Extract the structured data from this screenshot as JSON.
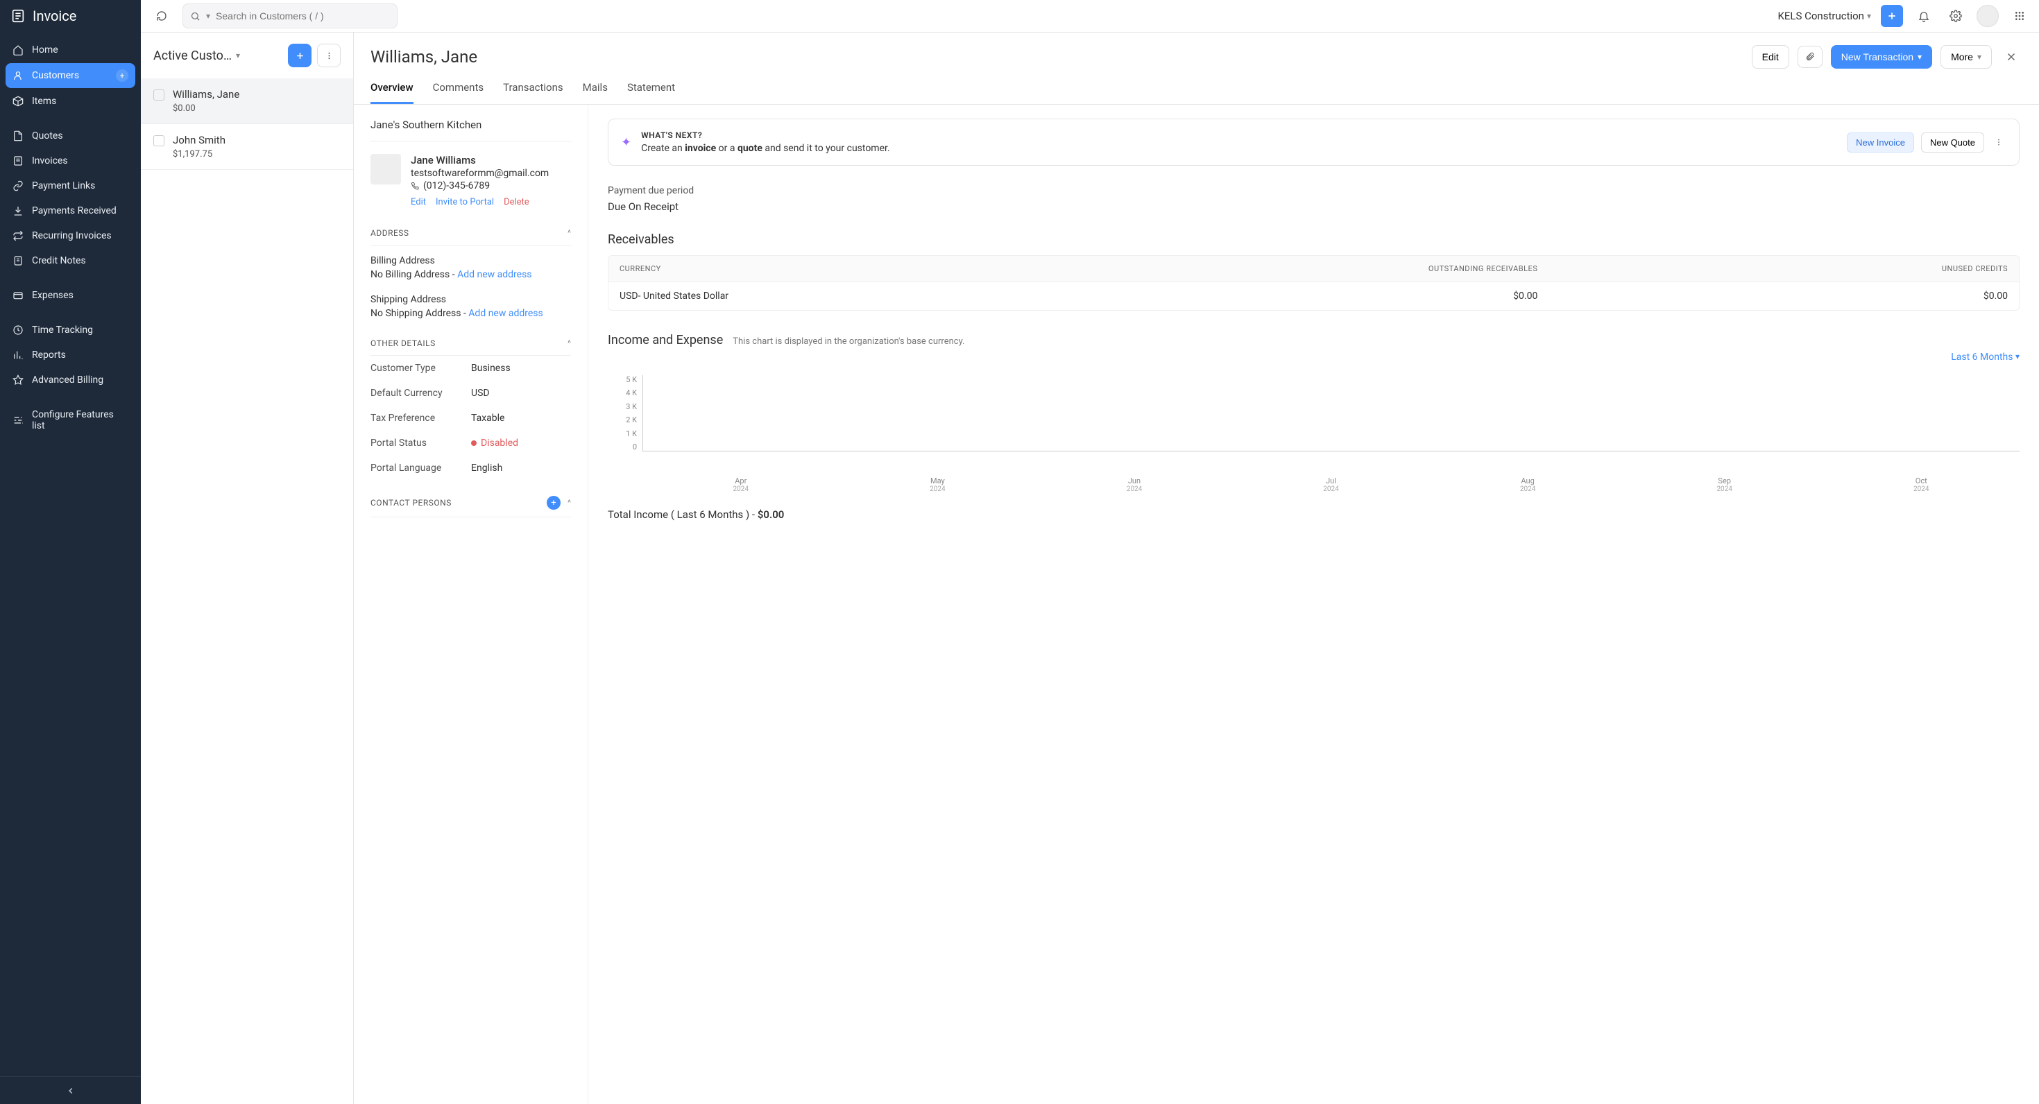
{
  "app": {
    "name": "Invoice"
  },
  "search": {
    "placeholder": "Search in Customers ( / )"
  },
  "org": {
    "name": "KELS Construction"
  },
  "sidebar": {
    "items": [
      {
        "label": "Home"
      },
      {
        "label": "Customers"
      },
      {
        "label": "Items"
      },
      {
        "label": "Quotes"
      },
      {
        "label": "Invoices"
      },
      {
        "label": "Payment Links"
      },
      {
        "label": "Payments Received"
      },
      {
        "label": "Recurring Invoices"
      },
      {
        "label": "Credit Notes"
      },
      {
        "label": "Expenses"
      },
      {
        "label": "Time Tracking"
      },
      {
        "label": "Reports"
      },
      {
        "label": "Advanced Billing"
      },
      {
        "label": "Configure Features list"
      }
    ]
  },
  "listHeader": {
    "title": "Active Custo…"
  },
  "customers": [
    {
      "name": "Williams, Jane",
      "amount": "$0.00"
    },
    {
      "name": "John Smith",
      "amount": "$1,197.75"
    }
  ],
  "detail": {
    "title": "Williams, Jane",
    "buttons": {
      "edit": "Edit",
      "newTxn": "New Transaction",
      "more": "More"
    },
    "tabs": [
      "Overview",
      "Comments",
      "Transactions",
      "Mails",
      "Statement"
    ],
    "company": "Jane's Southern Kitchen",
    "contact": {
      "name": "Jane Williams",
      "email": "testsoftwareformm@gmail.com",
      "phone": "(012)-345-6789",
      "actions": {
        "edit": "Edit",
        "invite": "Invite to Portal",
        "delete": "Delete"
      }
    },
    "addressSection": {
      "title": "ADDRESS",
      "billing": {
        "label": "Billing Address",
        "empty": "No Billing Address - ",
        "add": "Add new address"
      },
      "shipping": {
        "label": "Shipping Address",
        "empty": "No Shipping Address - ",
        "add": "Add new address"
      }
    },
    "otherSection": {
      "title": "OTHER DETAILS",
      "rows": {
        "custType": {
          "k": "Customer Type",
          "v": "Business"
        },
        "currency": {
          "k": "Default Currency",
          "v": "USD"
        },
        "tax": {
          "k": "Tax Preference",
          "v": "Taxable"
        },
        "portal": {
          "k": "Portal Status",
          "v": "Disabled"
        },
        "lang": {
          "k": "Portal Language",
          "v": "English"
        }
      }
    },
    "contactPersons": {
      "title": "CONTACT PERSONS"
    }
  },
  "whatsNext": {
    "title": "WHAT'S NEXT?",
    "text_pre": "Create an ",
    "text_bold1": "invoice",
    "text_mid": " or a ",
    "text_bold2": "quote",
    "text_post": " and send it to your customer.",
    "invoiceBtn": "New Invoice",
    "quoteBtn": "New Quote"
  },
  "duePeriod": {
    "label": "Payment due period",
    "value": "Due On Receipt"
  },
  "receivables": {
    "title": "Receivables",
    "headers": [
      "CURRENCY",
      "OUTSTANDING RECEIVABLES",
      "UNUSED CREDITS"
    ],
    "rows": [
      {
        "currency": "USD- United States Dollar",
        "outstanding": "$0.00",
        "unused": "$0.00"
      }
    ]
  },
  "income": {
    "title": "Income and Expense",
    "subtitle": "This chart is displayed in the organization's base currency.",
    "period": "Last 6 Months",
    "total_pre": "Total Income ( Last 6 Months ) - ",
    "total_val": "$0.00"
  },
  "chart_data": {
    "type": "bar",
    "title": "Income and Expense",
    "ylabel": "",
    "ylim": [
      0,
      5000
    ],
    "y_ticks": [
      "5 K",
      "4 K",
      "3 K",
      "2 K",
      "1 K",
      "0"
    ],
    "categories": [
      "Apr 2024",
      "May 2024",
      "Jun 2024",
      "Jul 2024",
      "Aug 2024",
      "Sep 2024",
      "Oct 2024"
    ],
    "x_ticks": [
      {
        "m": "Apr",
        "y": "2024"
      },
      {
        "m": "May",
        "y": "2024"
      },
      {
        "m": "Jun",
        "y": "2024"
      },
      {
        "m": "Jul",
        "y": "2024"
      },
      {
        "m": "Aug",
        "y": "2024"
      },
      {
        "m": "Sep",
        "y": "2024"
      },
      {
        "m": "Oct",
        "y": "2024"
      }
    ],
    "series": [
      {
        "name": "Income",
        "values": [
          0,
          0,
          0,
          0,
          0,
          0,
          0
        ]
      }
    ]
  }
}
